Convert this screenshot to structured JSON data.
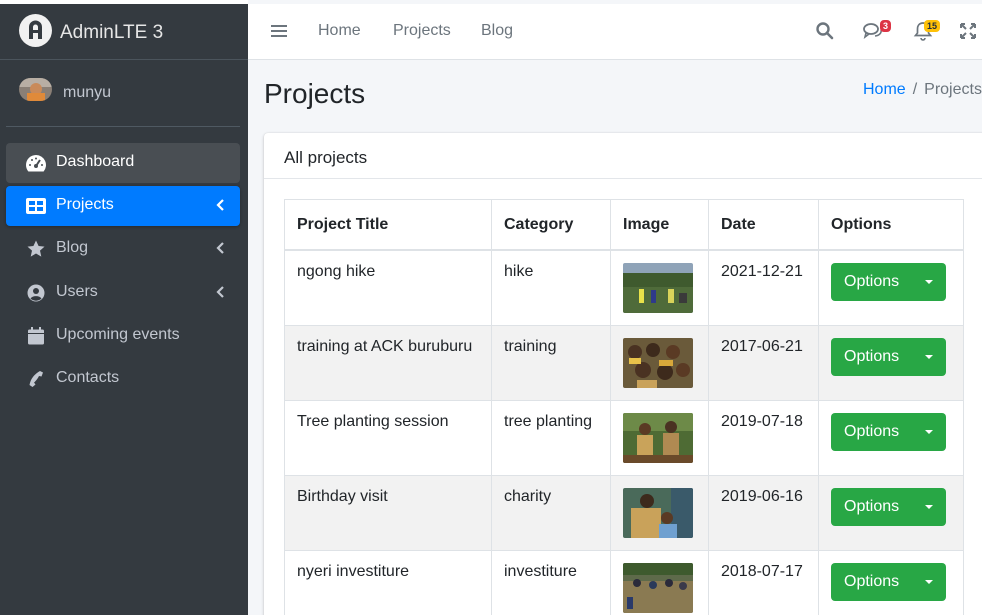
{
  "brand": {
    "name": "AdminLTE 3"
  },
  "user": {
    "name": "munyu"
  },
  "sidebar": {
    "items": [
      {
        "label": "Dashboard",
        "icon": "tachometer-icon"
      },
      {
        "label": "Projects",
        "icon": "table-icon",
        "active": true,
        "has_arrow": true
      },
      {
        "label": "Blog",
        "icon": "star-icon",
        "has_arrow": true
      },
      {
        "label": "Users",
        "icon": "user-circle-icon",
        "has_arrow": true
      },
      {
        "label": "Upcoming events",
        "icon": "calendar-icon"
      },
      {
        "label": "Contacts",
        "icon": "phone-icon"
      }
    ]
  },
  "topnav": {
    "links": [
      "Home",
      "Projects",
      "Blog"
    ],
    "messages_badge": "3",
    "notifications_badge": "15"
  },
  "page": {
    "title": "Projects",
    "breadcrumb": {
      "home": "Home",
      "separator": "/",
      "current": "Projects"
    }
  },
  "card": {
    "title": "All projects"
  },
  "table": {
    "headers": [
      "Project Title",
      "Category",
      "Image",
      "Date",
      "Options"
    ],
    "rows": [
      {
        "title": "ngong hike",
        "category": "hike",
        "date": "2021-12-21",
        "option": "Options"
      },
      {
        "title": "training at ACK buruburu",
        "category": "training",
        "date": "2017-06-21",
        "option": "Options"
      },
      {
        "title": "Tree planting session",
        "category": "tree planting",
        "date": "2019-07-18",
        "option": "Options"
      },
      {
        "title": "Birthday visit",
        "category": "charity",
        "date": "2019-06-16",
        "option": "Options"
      },
      {
        "title": "nyeri investiture",
        "category": "investiture",
        "date": "2018-07-17",
        "option": "Options"
      }
    ]
  },
  "colors": {
    "sidebar_bg": "#343a40",
    "active_nav": "#007bff",
    "options_button": "#28a745",
    "content_bg": "#f4f6f9",
    "badge_danger": "#dc3545",
    "badge_warning": "#ffc107"
  }
}
